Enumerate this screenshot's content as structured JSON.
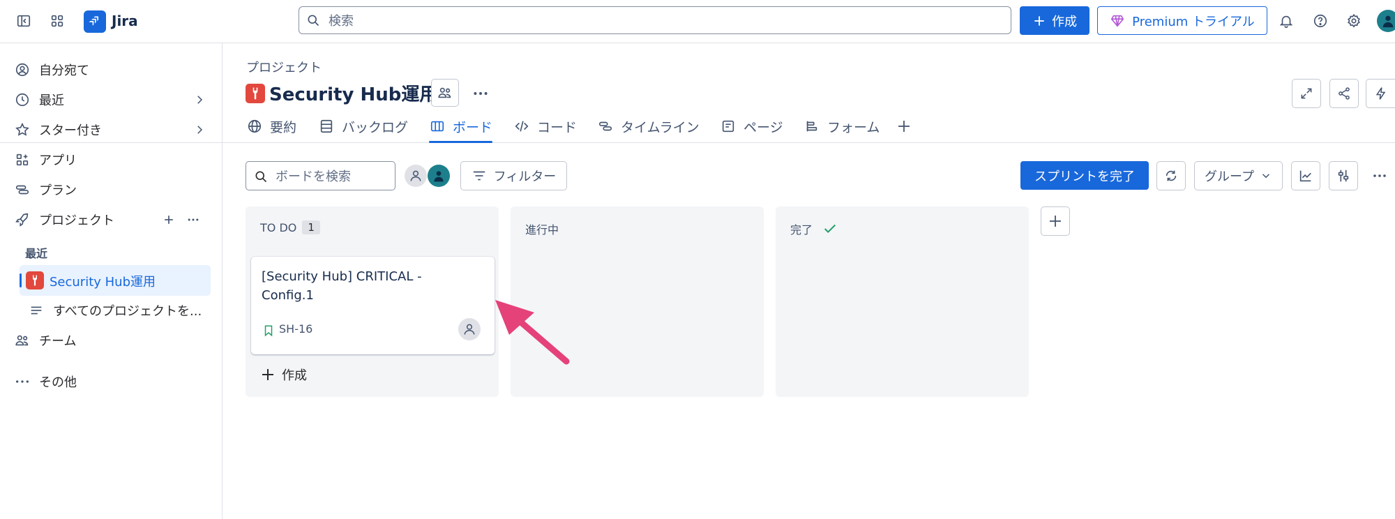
{
  "app": {
    "name": "Jira"
  },
  "topbar": {
    "search_placeholder": "検索",
    "create_label": "作成",
    "premium_label": "Premium トライアル"
  },
  "sidebar": {
    "items": [
      {
        "label": "自分宛て"
      },
      {
        "label": "最近"
      },
      {
        "label": "スター付き"
      },
      {
        "label": "アプリ"
      },
      {
        "label": "プラン"
      },
      {
        "label": "プロジェクト"
      }
    ],
    "recent_header": "最近",
    "recent_project": "Security Hub運用",
    "all_projects": "すべてのプロジェクトを...",
    "teams": "チーム",
    "more": "その他"
  },
  "project": {
    "breadcrumb": "プロジェクト",
    "title": "Security Hub運用"
  },
  "tabs": [
    {
      "label": "要約"
    },
    {
      "label": "バックログ"
    },
    {
      "label": "ボード"
    },
    {
      "label": "コード"
    },
    {
      "label": "タイムライン"
    },
    {
      "label": "ページ"
    },
    {
      "label": "フォーム"
    }
  ],
  "toolbar": {
    "search_placeholder": "ボードを検索",
    "filter_label": "フィルター",
    "complete_sprint_label": "スプリントを完了",
    "group_label": "グループ"
  },
  "columns": [
    {
      "name": "TO DO",
      "count": "1"
    },
    {
      "name": "進行中"
    },
    {
      "name": "完了"
    }
  ],
  "card": {
    "title": "[Security Hub] CRITICAL - Config.1",
    "key": "SH-16"
  },
  "column_create_label": "作成",
  "colors": {
    "primary": "#1868db",
    "project_icon": "#e2483d",
    "arrow": "#e5427a",
    "done_check": "#22a06b"
  }
}
